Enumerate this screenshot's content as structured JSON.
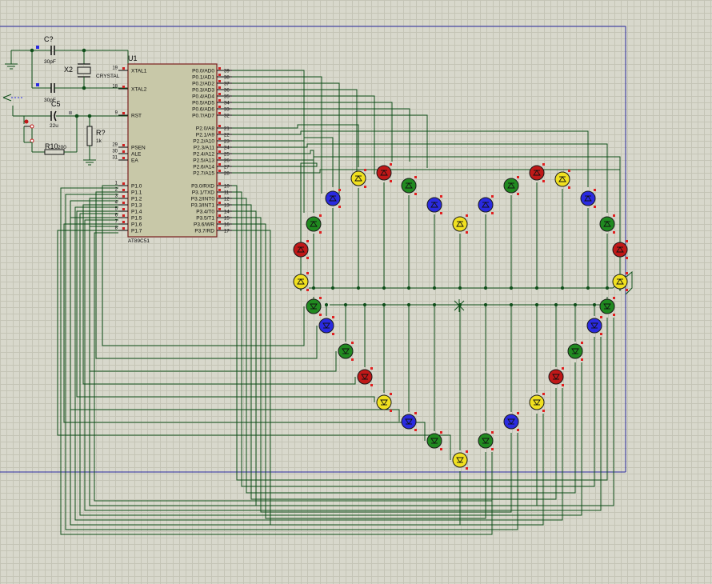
{
  "mcu": {
    "ref": "U1",
    "part": "AT89C51",
    "left_pins": [
      {
        "num": "19",
        "name": "XTAL1"
      },
      {
        "num": "18",
        "name": "XTAL2"
      },
      {
        "num": "9",
        "name": "RST"
      },
      {
        "num": "29",
        "name": "PSEN"
      },
      {
        "num": "30",
        "name": "ALE"
      },
      {
        "num": "31",
        "name": "EA"
      },
      {
        "num": "1",
        "name": "P1.0"
      },
      {
        "num": "2",
        "name": "P1.1"
      },
      {
        "num": "3",
        "name": "P1.2"
      },
      {
        "num": "4",
        "name": "P1.3"
      },
      {
        "num": "5",
        "name": "P1.4"
      },
      {
        "num": "6",
        "name": "P1.5"
      },
      {
        "num": "7",
        "name": "P1.6"
      },
      {
        "num": "8",
        "name": "P1.7"
      }
    ],
    "right_pins": [
      {
        "num": "39",
        "name": "P0.0/AD0"
      },
      {
        "num": "38",
        "name": "P0.1/AD1"
      },
      {
        "num": "37",
        "name": "P0.2/AD2"
      },
      {
        "num": "36",
        "name": "P0.3/AD3"
      },
      {
        "num": "35",
        "name": "P0.4/AD4"
      },
      {
        "num": "34",
        "name": "P0.5/AD5"
      },
      {
        "num": "33",
        "name": "P0.6/AD6"
      },
      {
        "num": "32",
        "name": "P0.7/AD7"
      },
      {
        "num": "21",
        "name": "P2.0/A8"
      },
      {
        "num": "22",
        "name": "P2.1/A9"
      },
      {
        "num": "23",
        "name": "P2.2/A10"
      },
      {
        "num": "24",
        "name": "P2.3/A11"
      },
      {
        "num": "25",
        "name": "P2.4/A12"
      },
      {
        "num": "26",
        "name": "P2.5/A13"
      },
      {
        "num": "27",
        "name": "P2.6/A14"
      },
      {
        "num": "28",
        "name": "P2.7/A15"
      },
      {
        "num": "10",
        "name": "P3.0/RXD"
      },
      {
        "num": "11",
        "name": "P3.1/TXD"
      },
      {
        "num": "12",
        "name": "P3.2/INT0"
      },
      {
        "num": "13",
        "name": "P3.3/INT1"
      },
      {
        "num": "14",
        "name": "P3.4/T0"
      },
      {
        "num": "15",
        "name": "P3.5/T1"
      },
      {
        "num": "16",
        "name": "P3.6/WR"
      },
      {
        "num": "17",
        "name": "P3.7/RD"
      }
    ]
  },
  "components": {
    "c1_ref": "C?",
    "c1_val": "30pF",
    "c2_ref": "C4",
    "c2_val": "30pF",
    "x2_ref": "X2",
    "x2_val": "CRYSTAL",
    "c5_ref": "C5",
    "c5_val": "22u",
    "r1_ref": "R?",
    "r1_val": "1k",
    "r10_ref": "R10",
    "r10_val": "200"
  },
  "colors": {
    "wire": "#0f4f1a",
    "chip_fill": "#c8c8a8",
    "chip_border": "#7a1e1e",
    "frame": "#2a2aa0",
    "led_red": "#c01818",
    "led_green": "#208a20",
    "led_blue": "#2a2ae0",
    "led_yellow": "#f0e020"
  },
  "leds": [
    {
      "color": "red"
    },
    {
      "color": "yellow"
    },
    {
      "color": "green"
    },
    {
      "color": "blue"
    },
    {
      "color": "yellow"
    },
    {
      "color": "red"
    },
    {
      "color": "green"
    },
    {
      "color": "blue"
    },
    {
      "color": "yellow"
    },
    {
      "color": "blue"
    },
    {
      "color": "green"
    },
    {
      "color": "red"
    },
    {
      "color": "yellow"
    },
    {
      "color": "blue"
    },
    {
      "color": "green"
    },
    {
      "color": "red"
    },
    {
      "color": "yellow"
    },
    {
      "color": "green"
    },
    {
      "color": "blue"
    },
    {
      "color": "green"
    },
    {
      "color": "red"
    },
    {
      "color": "yellow"
    },
    {
      "color": "blue"
    },
    {
      "color": "green"
    },
    {
      "color": "yellow"
    },
    {
      "color": "green"
    },
    {
      "color": "blue"
    },
    {
      "color": "yellow"
    },
    {
      "color": "red"
    },
    {
      "color": "green"
    },
    {
      "color": "blue"
    },
    {
      "color": "green"
    }
  ]
}
